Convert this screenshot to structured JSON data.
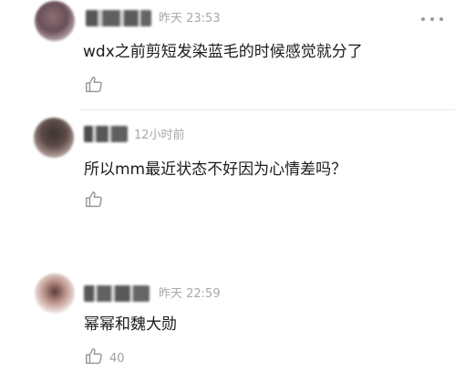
{
  "comments": [
    {
      "timestamp": "昨天 23:53",
      "text": "wdx之前剪短发染蓝毛的时候感觉就分了",
      "likes": ""
    },
    {
      "timestamp": "12小时前",
      "text": "所以mm最近状态不好因为心情差吗？",
      "likes": ""
    },
    {
      "timestamp": "昨天 22:59",
      "text": "幂幂和魏大勋",
      "likes": "40"
    }
  ],
  "icons": {
    "like": "thumbs-up-icon",
    "more": "more-dots-icon"
  },
  "colors": {
    "timestamp": "#a8a8a8",
    "text": "#1c1c1c",
    "icon": "#9a9a9a",
    "divider": "#e9e9e9"
  }
}
